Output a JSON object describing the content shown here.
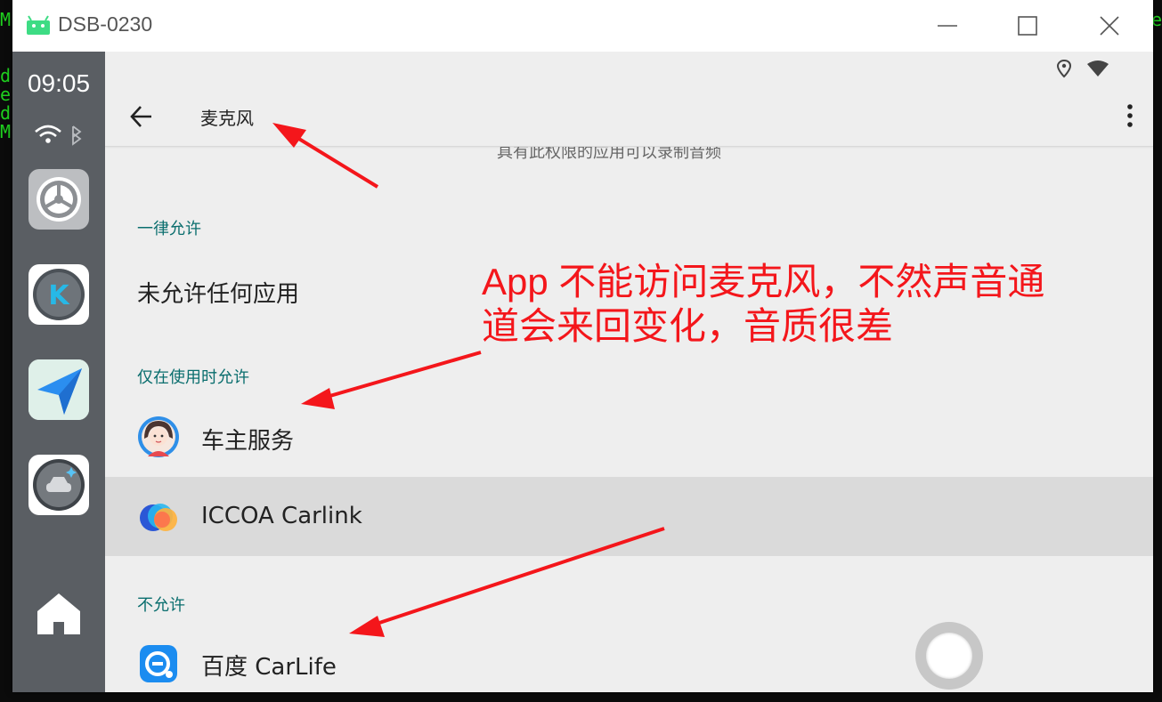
{
  "window": {
    "title": "DSB-0230"
  },
  "dock": {
    "time": "09:05",
    "apps": [
      {
        "name": "settings"
      },
      {
        "name": "k-app"
      },
      {
        "name": "navigation"
      },
      {
        "name": "car-app"
      }
    ]
  },
  "appbar": {
    "title": "麦克风"
  },
  "content": {
    "cut_text": "具有此权限的应用可以录制音频",
    "sections": {
      "always": "一律允许",
      "while_using": "仅在使用时允许",
      "denied": "不允许"
    },
    "always_item": "未允许任何应用",
    "while_using_items": [
      "车主服务",
      "ICCOA Carlink"
    ],
    "denied_items": [
      "百度 CarLife"
    ]
  },
  "annotation": {
    "line1": "App 不能访问麦克风，不然声音通",
    "line2": "道会来回变化，音质很差"
  },
  "colors": {
    "annotation": "#f4161b",
    "section_header": "#0a6e6e",
    "dock": "#5a5e63"
  },
  "icons": [
    "android-icon",
    "minimize-icon",
    "maximize-icon",
    "close-icon",
    "wifi-icon",
    "bluetooth-icon",
    "back-arrow-icon",
    "overflow-menu-icon",
    "home-icon",
    "location-icon",
    "signal-icon"
  ]
}
